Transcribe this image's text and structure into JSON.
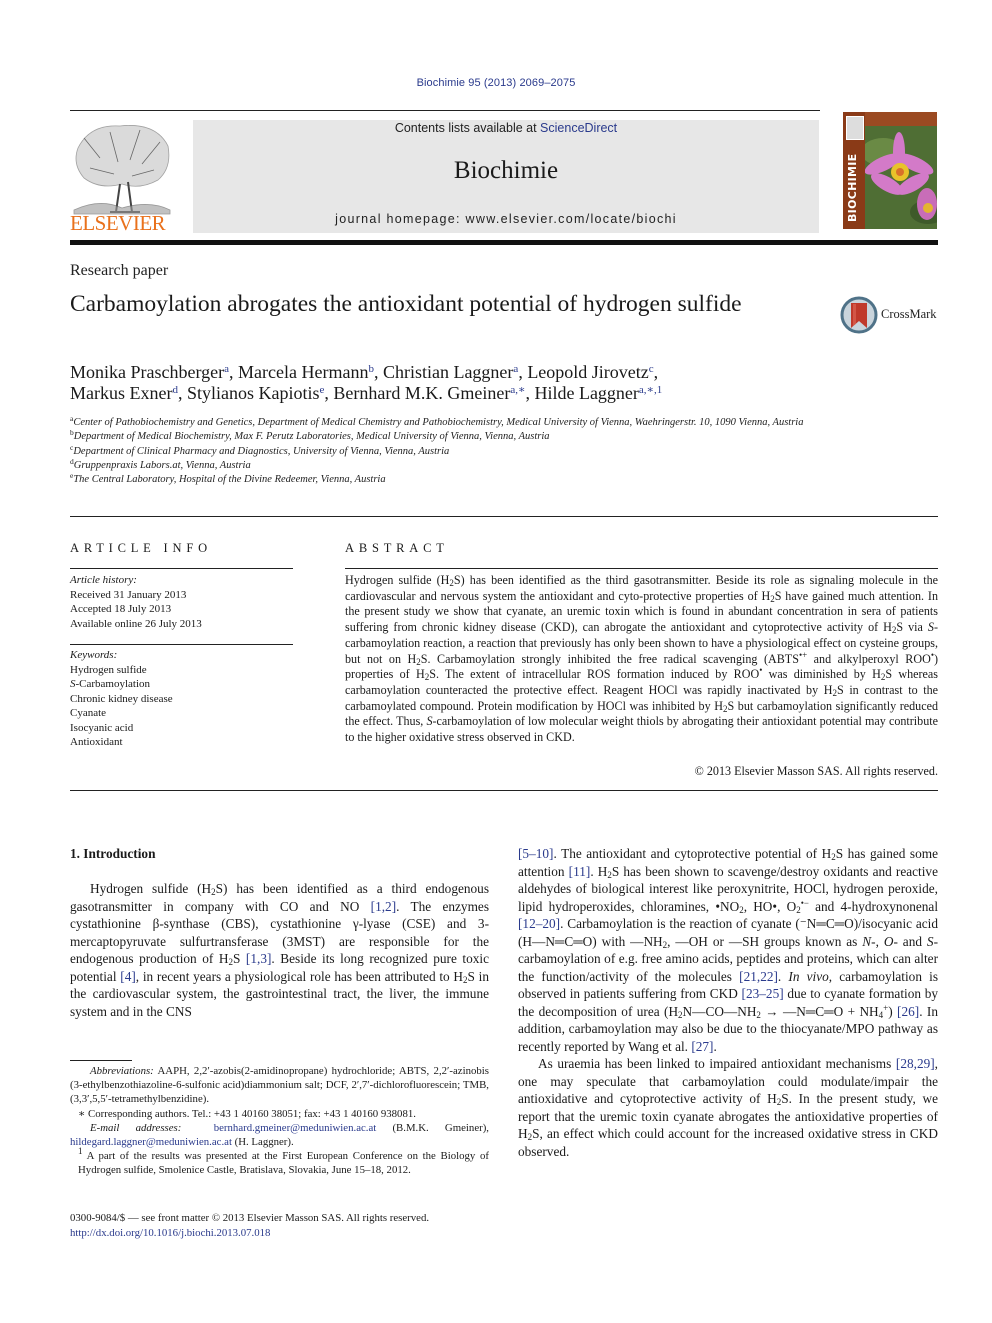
{
  "header": {
    "journal_ref": "Biochimie 95 (2013) 2069–2075",
    "contents_prefix": "Contents lists available at ",
    "contents_link": "ScienceDirect",
    "journal_name": "Biochimie",
    "homepage": "journal homepage: www.elsevier.com/locate/biochi",
    "publisher_logo_text": "ELSEVIER",
    "cover_spine_text": "BIOCHIMIE",
    "colors": {
      "publisher_orange": "#e9711c",
      "link_blue": "#2a3a8c",
      "banner_gray": "#e7e7e7",
      "cover_brown": "#8a3a17"
    }
  },
  "article": {
    "section_type": "Research paper",
    "title": "Carbamoylation abrogates the antioxidant potential of hydrogen sulfide",
    "crossmark_label": "CrossMark",
    "authors": [
      {
        "name": "Monika Praschberger",
        "sup": "a",
        "sep": ", "
      },
      {
        "name": "Marcela Hermann",
        "sup": "b",
        "sep": ", "
      },
      {
        "name": "Christian Laggner",
        "sup": "a",
        "sep": ", "
      },
      {
        "name": "Leopold Jirovetz",
        "sup": "c",
        "sep": ","
      },
      {
        "name": "Markus Exner",
        "sup": "d",
        "sep": ", "
      },
      {
        "name": "Stylianos Kapiotis",
        "sup": "e",
        "sep": ", "
      },
      {
        "name": "Bernhard M.K. Gmeiner",
        "sup": "a,∗",
        "sep": ", "
      },
      {
        "name": "Hilde Laggner",
        "sup": "a,∗,1",
        "sep": ""
      }
    ],
    "affiliations": [
      {
        "key": "a",
        "text": "Center of Pathobiochemistry and Genetics, Department of Medical Chemistry and Pathobiochemistry, Medical University of Vienna, Waehringerstr. 10, 1090 Vienna, Austria"
      },
      {
        "key": "b",
        "text": "Department of Medical Biochemistry, Max F. Perutz Laboratories, Medical University of Vienna, Vienna, Austria"
      },
      {
        "key": "c",
        "text": "Department of Clinical Pharmacy and Diagnostics, University of Vienna, Vienna, Austria"
      },
      {
        "key": "d",
        "text": "Gruppenpraxis Labors.at, Vienna, Austria"
      },
      {
        "key": "e",
        "text": "The Central Laboratory, Hospital of the Divine Redeemer, Vienna, Austria"
      }
    ]
  },
  "article_info": {
    "heading": "ARTICLE INFO",
    "history_label": "Article history:",
    "history": [
      "Received 31 January 2013",
      "Accepted 18 July 2013",
      "Available online 26 July 2013"
    ],
    "keywords_label": "Keywords:",
    "keywords": [
      "Hydrogen sulfide",
      "S-Carbamoylation",
      "Chronic kidney disease",
      "Cyanate",
      "Isocyanic acid",
      "Antioxidant"
    ]
  },
  "abstract": {
    "heading": "ABSTRACT",
    "segments": [
      "Hydrogen sulfide (H",
      "2",
      "S) has been identified as the third gasotransmitter. Beside its role as signaling molecule in the cardiovascular and nervous system the antioxidant and cyto-protective properties of H",
      "2",
      "S have gained much attention. In the present study we show that cyanate, an uremic toxin which is found in abundant concentration in sera of patients suffering from chronic kidney disease (CKD), can abrogate the antioxidant and cytoprotective activity of H",
      "2",
      "S via ",
      "S",
      "-carbamoylation reaction, a reaction that previously has only been shown to have a physiological effect on cysteine groups, but not on H",
      "2",
      "S. Carbamoylation strongly inhibited the free radical scavenging (ABTS",
      "•+",
      " and alkylperoxyl ROO",
      "•",
      ") properties of H",
      "2",
      "S. The extent of intracellular ROS formation induced by ROO",
      "•",
      " was diminished by H",
      "2",
      "S whereas carbamoylation counteracted the protective effect. Reagent HOCl was rapidly inactivated by H",
      "2",
      "S in contrast to the carbamoylated compound. Protein modification by HOCl was inhibited by H",
      "2",
      "S but carbamoylation significantly reduced the effect. Thus, ",
      "S",
      "-carbamoylation of low molecular weight thiols by abrogating their antioxidant potential may contribute to the higher oxidative stress observed in CKD."
    ],
    "copyright": "© 2013 Elsevier Masson SAS. All rights reserved."
  },
  "introduction": {
    "heading": "1.  Introduction",
    "left_para": [
      {
        "t": "Hydrogen sulfide (H"
      },
      {
        "sub": "2"
      },
      {
        "t": "S) has been identified as a third endogenous gasotransmitter in company with CO and NO "
      },
      {
        "ref": "[1,2]"
      },
      {
        "t": ". The enzymes cystathionine β-synthase (CBS), cystathionine γ-lyase (CSE) and 3-mercaptopyruvate sulfurtransferase (3MST) are responsible for the endogenous production of H"
      },
      {
        "sub": "2"
      },
      {
        "t": "S "
      },
      {
        "ref": "[1,3]"
      },
      {
        "t": ". Beside its long recognized pure toxic potential "
      },
      {
        "ref": "[4]"
      },
      {
        "t": ", in recent years a physiological role has been attributed to H"
      },
      {
        "sub": "2"
      },
      {
        "t": "S in the cardiovascular system, the gastrointestinal tract, the liver, the immune system and in the CNS"
      }
    ],
    "right_para1": [
      {
        "ref": "[5–10]"
      },
      {
        "t": ". The antioxidant and cytoprotective potential of H"
      },
      {
        "sub": "2"
      },
      {
        "t": "S has gained some attention "
      },
      {
        "ref": "[11]"
      },
      {
        "t": ". H"
      },
      {
        "sub": "2"
      },
      {
        "t": "S has been shown to scavenge/destroy oxidants and reactive aldehydes of biological interest like peroxynitrite, HOCl, hydrogen peroxide, lipid hydroperoxides, chloramines, •NO"
      },
      {
        "sub": "2"
      },
      {
        "t": ", HO•, O"
      },
      {
        "sub": "2"
      },
      {
        "sup": "•−"
      },
      {
        "t": " and 4-hydroxynonenal "
      },
      {
        "ref": "[12–20]"
      },
      {
        "t": ". Carbamoylation is the reaction of cyanate (⁻N═C═O)/isocyanic acid (H—N═C═O) with —NH"
      },
      {
        "sub": "2"
      },
      {
        "t": ", —OH or —SH groups known as "
      },
      {
        "i": "N"
      },
      {
        "t": "-, "
      },
      {
        "i": "O"
      },
      {
        "t": "- and "
      },
      {
        "i": "S"
      },
      {
        "t": "-carbamoylation of e.g. free amino acids, peptides and proteins, which can alter the function/activity of the molecules "
      },
      {
        "ref": "[21,22]"
      },
      {
        "t": ". "
      },
      {
        "i": "In vivo"
      },
      {
        "t": ", carbamoylation is observed in patients suffering from CKD "
      },
      {
        "ref": "[23–25]"
      },
      {
        "t": " due to cyanate formation by the decomposition of urea (H"
      },
      {
        "sub": "2"
      },
      {
        "t": "N—CO—NH"
      },
      {
        "sub": "2"
      },
      {
        "t": " → —N═C═O + NH"
      },
      {
        "sub": "4"
      },
      {
        "sup": "+"
      },
      {
        "t": ") "
      },
      {
        "ref": "[26]"
      },
      {
        "t": ". In addition, carbamoylation may also be due to the thiocyanate/MPO pathway as recently reported by Wang et al. "
      },
      {
        "ref": "[27]"
      },
      {
        "t": "."
      }
    ],
    "right_para2": [
      {
        "t": "As uraemia has been linked to impaired antioxidant mechanisms "
      },
      {
        "ref": "[28,29]"
      },
      {
        "t": ", one may speculate that carbamoylation could modulate/impair the antioxidative and cytoprotective activity of H"
      },
      {
        "sub": "2"
      },
      {
        "t": "S. In the present study, we report that the uremic toxin cyanate abrogates the antioxidative properties of H"
      },
      {
        "sub": "2"
      },
      {
        "t": "S, an effect which could account for the increased oxidative stress in CKD observed."
      }
    ]
  },
  "footnotes": {
    "abbrev_label": "Abbreviations:",
    "abbrev_text": " AAPH, 2,2′-azobis(2-amidinopropane) hydrochloride; ABTS, 2,2′-azinobis (3-ethylbenzothiazoline-6-sulfonic acid)diammonium salt; DCF, 2′,7′-dichlorofluorescein; TMB, (3,3′,5,5′-tetramethylbenzidine).",
    "corresponding": "∗  Corresponding authors. Tel.: +43 1 40160 38051; fax: +43 1 40160 938081.",
    "email_label": "E-mail addresses:",
    "email1": "bernhard.gmeiner@meduniwien.ac.at",
    "email1_owner": " (B.M.K. Gmeiner),",
    "email2": "hildegard.laggner@meduniwien.ac.at",
    "email2_owner": " (H. Laggner).",
    "note1_mark": "1",
    "note1_text": " A part of the results was presented at the First European Conference on the Biology of Hydrogen sulfide, Smolenice Castle, Bratislava, Slovakia, June 15–18, 2012.",
    "issn_line": "0300-9084/$ — see front matter © 2013 Elsevier Masson SAS. All rights reserved.",
    "doi": "http://dx.doi.org/10.1016/j.biochi.2013.07.018"
  }
}
